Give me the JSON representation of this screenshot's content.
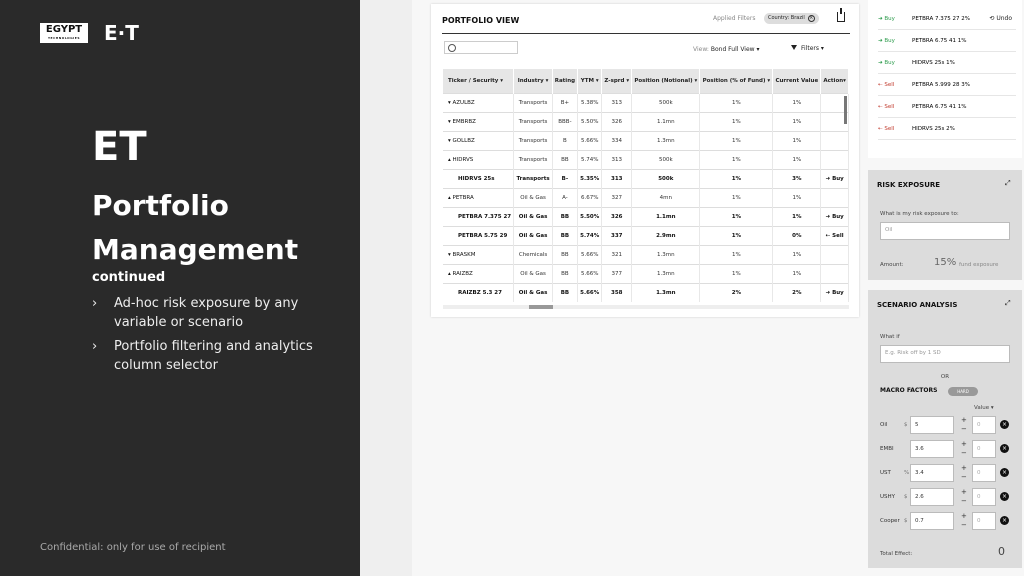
{
  "brand": {
    "logo_main": "EGYPT",
    "logo_sub": "TECHNOLOGIES",
    "logo_alt": "E·T"
  },
  "slide": {
    "title": "ET",
    "subtitle": "Portfolio Management",
    "continued": "continued",
    "bullets": [
      "Ad-hoc risk exposure by any variable or scenario",
      "Portfolio filtering and analytics column selector"
    ],
    "confidential": "Confidential: only for use of recipient",
    "chevron": "›"
  },
  "portfolio": {
    "title": "PORTFOLIO VIEW",
    "applied_filters": "Applied Filters",
    "country_chip": "Country: Brazil",
    "view_label": "View:",
    "view_value": "Bond Full View ▾",
    "filters_label": "Filters ▾",
    "columns": [
      "Ticker / Security ▾",
      "Industry ▾",
      "Rating",
      "YTM ▾",
      "Z-sprd ▾",
      "Position (Notional) ▾",
      "Position (% of Fund) ▾",
      "Current Value",
      "Action▾"
    ],
    "rows": [
      {
        "sub": false,
        "cells": [
          "▾ AZULBZ",
          "Transports",
          "B+",
          "5.38%",
          "313",
          "500k",
          "1%",
          "1%",
          ""
        ]
      },
      {
        "sub": false,
        "cells": [
          "▾ EMBRBZ",
          "Transports",
          "BBB-",
          "5.50%",
          "326",
          "1.1mn",
          "1%",
          "1%",
          ""
        ]
      },
      {
        "sub": false,
        "cells": [
          "▾ GOLLBZ",
          "Transports",
          "B",
          "5.66%",
          "334",
          "1.3mn",
          "1%",
          "1%",
          ""
        ]
      },
      {
        "sub": false,
        "cells": [
          "▴ HIDRVS",
          "Transports",
          "BB",
          "5.74%",
          "313",
          "500k",
          "1%",
          "1%",
          ""
        ]
      },
      {
        "sub": true,
        "cells": [
          "HIDRVS 25s",
          "Transports",
          "B-",
          "5.35%",
          "313",
          "500k",
          "1%",
          "3%",
          "➜ Buy"
        ]
      },
      {
        "sub": false,
        "cells": [
          "▴ PETBRA",
          "Oil & Gas",
          "A-",
          "6.67%",
          "327",
          "4mn",
          "1%",
          "1%",
          ""
        ]
      },
      {
        "sub": true,
        "cells": [
          "PETBRA 7.375 27",
          "Oil & Gas",
          "BB",
          "5.50%",
          "326",
          "1.1mn",
          "1%",
          "1%",
          "➜ Buy"
        ]
      },
      {
        "sub": true,
        "cells": [
          "PETBRA 5.75 29",
          "Oil & Gas",
          "BB",
          "5.74%",
          "337",
          "2.9mn",
          "1%",
          "0%",
          "⇠ Sell"
        ]
      },
      {
        "sub": false,
        "cells": [
          "▾ BRASKM",
          "Chemicals",
          "BB",
          "5.66%",
          "321",
          "1.3mn",
          "1%",
          "1%",
          ""
        ]
      },
      {
        "sub": false,
        "cells": [
          "▴ RAIZBZ",
          "Oil & Gas",
          "BB",
          "5.66%",
          "377",
          "1.3mn",
          "1%",
          "1%",
          ""
        ]
      },
      {
        "sub": true,
        "cells": [
          "RAIZBZ 5.3 27",
          "Oil & Gas",
          "BB",
          "5.66%",
          "358",
          "1.3mn",
          "2%",
          "2%",
          "➜ Buy"
        ]
      }
    ]
  },
  "trades": {
    "undo_label": "⟲ Undo",
    "items": [
      {
        "action": "➜ Buy",
        "kind": "buy",
        "text": "PETBRA 7.375 27  2%"
      },
      {
        "action": "➜ Buy",
        "kind": "buy",
        "text": "PETBRA 6.75 41  1%"
      },
      {
        "action": "➜ Buy",
        "kind": "buy",
        "text": "HIDRVS 25s  1%"
      },
      {
        "action": "⇠ Sell",
        "kind": "sell",
        "text": "PETBRA 5.999 28  3%"
      },
      {
        "action": "⇠ Sell",
        "kind": "sell",
        "text": "PETBRA 6.75 41  1%"
      },
      {
        "action": "⇠ Sell",
        "kind": "sell",
        "text": "HIDRVS 25s  2%"
      }
    ]
  },
  "risk": {
    "title": "RISK EXPOSURE",
    "question": "What is my risk exposure to:",
    "input_value": "Oil",
    "amount_label": "Amount:",
    "amount_value": "15%",
    "amount_suffix": "fund exposure"
  },
  "scenario": {
    "title": "SCENARIO ANALYSIS",
    "what_if": "What if",
    "what_if_placeholder": "E.g. Risk off by 1 SD",
    "or": "OR",
    "macro_title": "MACRO FACTORS",
    "macro_chip": "HARD",
    "value_header": "Value ▾",
    "factors": [
      {
        "name": "Oil",
        "unit": "$",
        "value": "5",
        "change": "0"
      },
      {
        "name": "EMBI",
        "unit": "",
        "value": "3.6",
        "change": "0"
      },
      {
        "name": "UST",
        "unit": "%",
        "value": "3.4",
        "change": "0"
      },
      {
        "name": "USHY",
        "unit": "$",
        "value": "2.6",
        "change": "0"
      },
      {
        "name": "Cooper",
        "unit": "$",
        "value": "0.7",
        "change": "0"
      }
    ],
    "total_label": "Total Effect:",
    "total_value": "0"
  }
}
